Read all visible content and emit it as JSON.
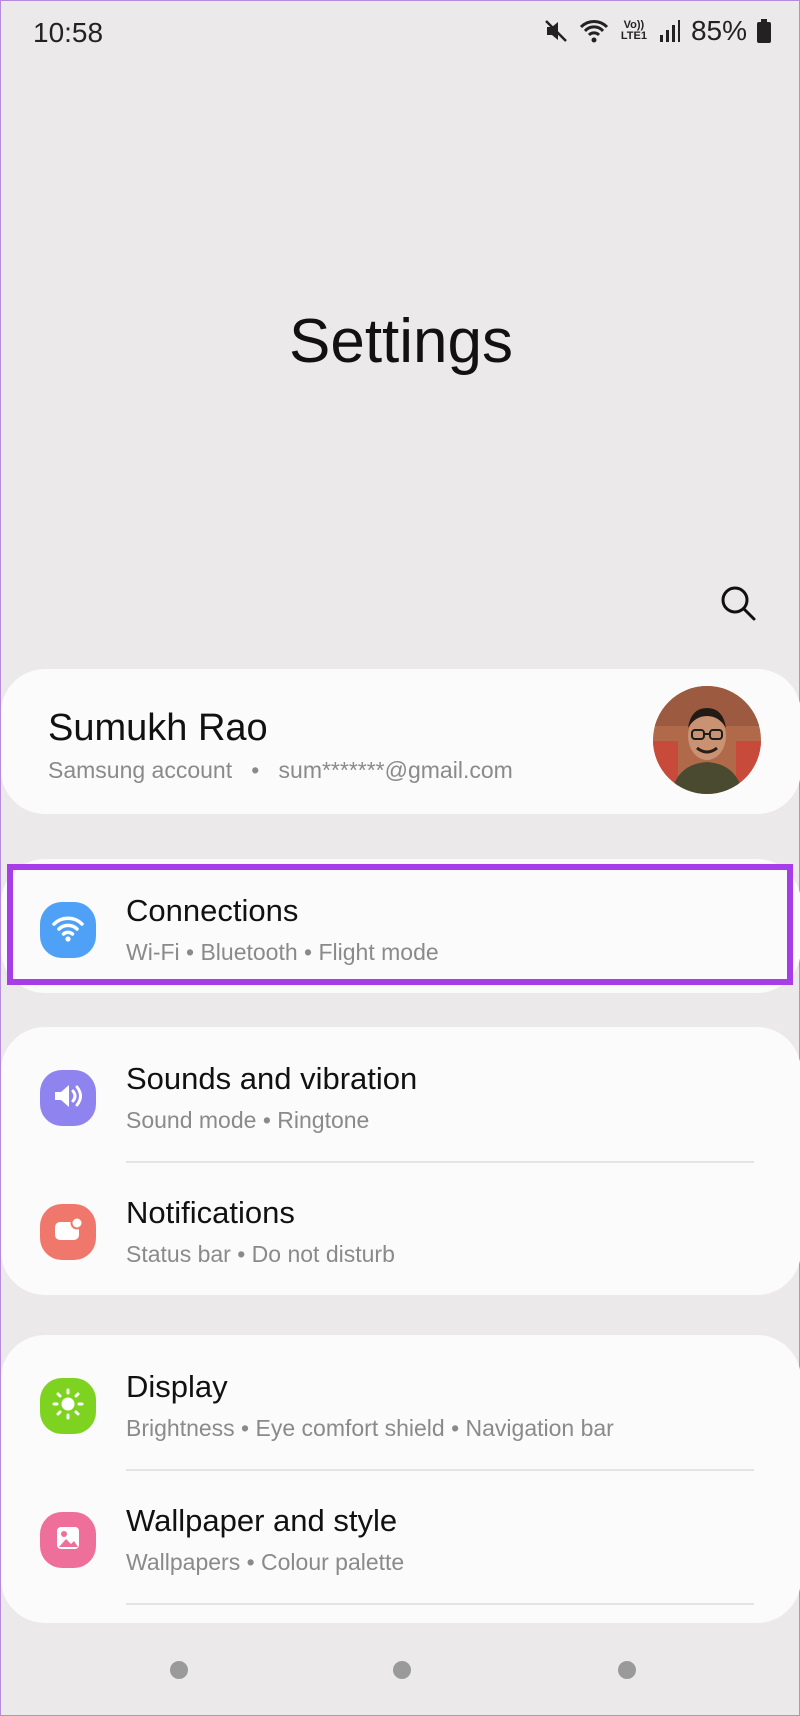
{
  "status_bar": {
    "time": "10:58",
    "network_label": "Vo)) LTE1",
    "battery": "85%"
  },
  "page": {
    "title": "Settings"
  },
  "search": {
    "icon": "search-icon"
  },
  "account": {
    "name": "Sumukh Rao",
    "subtitle_parts": [
      "Samsung account",
      "sum*******@gmail.com"
    ]
  },
  "connections": {
    "title": "Connections",
    "subtitle": "Wi-Fi  •  Bluetooth  •  Flight mode",
    "icon": "wifi-icon",
    "icon_color": "#4ea1f7"
  },
  "group2": [
    {
      "title": "Sounds and vibration",
      "subtitle": "Sound mode  •  Ringtone",
      "icon": "volume-icon",
      "icon_color": "#8f83f0"
    },
    {
      "title": "Notifications",
      "subtitle": "Status bar  •  Do not disturb",
      "icon": "notification-icon",
      "icon_color": "#f0776b"
    }
  ],
  "group3": [
    {
      "title": "Display",
      "subtitle": "Brightness  •  Eye comfort shield  •  Navigation bar",
      "icon": "brightness-icon",
      "icon_color": "#7ed321"
    },
    {
      "title": "Wallpaper and style",
      "subtitle": "Wallpapers  •  Colour palette",
      "icon": "wallpaper-icon",
      "icon_color": "#ef6f9b"
    }
  ],
  "colors": {
    "background": "#ece9ea",
    "card": "#fbfbfb",
    "highlight": "#a63de6"
  }
}
